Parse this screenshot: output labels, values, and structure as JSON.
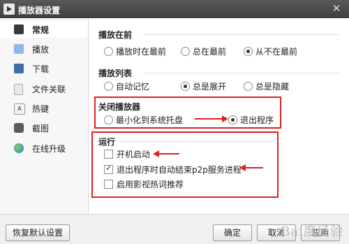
{
  "window": {
    "title": "播放器设置",
    "close_symbol": "✕"
  },
  "sidebar": {
    "items": [
      {
        "label": "常规",
        "icon": "monitor-icon",
        "active": true
      },
      {
        "label": "播放",
        "icon": "play-icon"
      },
      {
        "label": "下载",
        "icon": "film-icon"
      },
      {
        "label": "文件关联",
        "icon": "file-icon"
      },
      {
        "label": "热键",
        "icon": "key-icon"
      },
      {
        "label": "截图",
        "icon": "camera-icon"
      },
      {
        "label": "在线升级",
        "icon": "globe-icon"
      }
    ]
  },
  "sections": {
    "play_front": {
      "title": "播放在前",
      "options": [
        "播放时在最前",
        "总在最前",
        "从不在最前"
      ],
      "selected": "从不在最前"
    },
    "playlist": {
      "title": "播放列表",
      "options": [
        "自动记忆",
        "总是展开",
        "总是隐藏"
      ],
      "selected": "总是展开"
    },
    "close_player": {
      "title": "关闭播放器",
      "options": [
        "最小化到系统托盘",
        "退出程序"
      ],
      "selected": "退出程序"
    },
    "run": {
      "title": "运行",
      "checkboxes": [
        {
          "label": "开机启动",
          "checked": false
        },
        {
          "label": "退出程序时自动结束p2p服务进程",
          "checked": true
        },
        {
          "label": "启用影视热词推荐",
          "checked": false
        }
      ]
    }
  },
  "footer": {
    "restore_label": "恢复默认设置",
    "ok_label": "确定",
    "cancel_label": "取消",
    "apply_label": "应用"
  },
  "watermark": "Bai度经验",
  "colors": {
    "annotation_red": "#e02020",
    "titlebar": "#4a4a4a"
  }
}
